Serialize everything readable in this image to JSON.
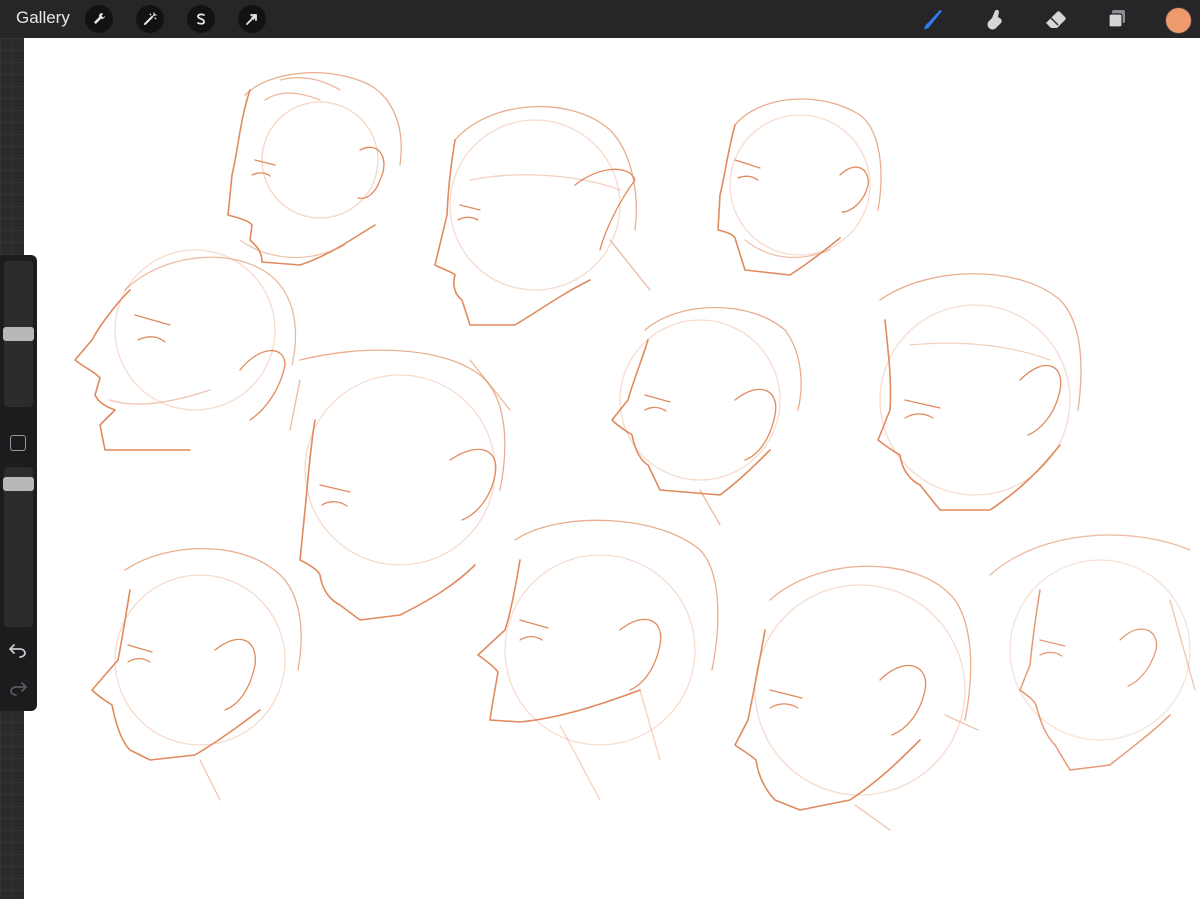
{
  "toolbar": {
    "gallery_label": "Gallery",
    "left_tools": [
      {
        "icon": "wrench-icon",
        "name": "actions"
      },
      {
        "icon": "magic-wand-icon",
        "name": "adjustments"
      },
      {
        "icon": "selection-s-icon",
        "name": "selection"
      },
      {
        "icon": "arrow-cursor-icon",
        "name": "transform"
      }
    ],
    "right_tools": [
      {
        "icon": "brush-icon",
        "name": "brush",
        "active": true
      },
      {
        "icon": "smudge-icon",
        "name": "smudge"
      },
      {
        "icon": "eraser-icon",
        "name": "eraser"
      },
      {
        "icon": "layers-icon",
        "name": "layers"
      }
    ],
    "current_color": "#ee9a6c"
  },
  "sidebar": {
    "brush_size_level": 0.5,
    "opacity_level": 0.93,
    "modify_icon": "square-icon",
    "undo_icon": "undo-arrow-icon",
    "redo_icon": "redo-arrow-icon"
  },
  "canvas": {
    "background": "#ffffff",
    "stroke_color": "#e08a5e",
    "content": "sketch-of-human-head-profiles"
  },
  "colors": {
    "topbar": "#262628",
    "active_tool": "#2f7cf6",
    "panel": "#1c1c1e"
  }
}
